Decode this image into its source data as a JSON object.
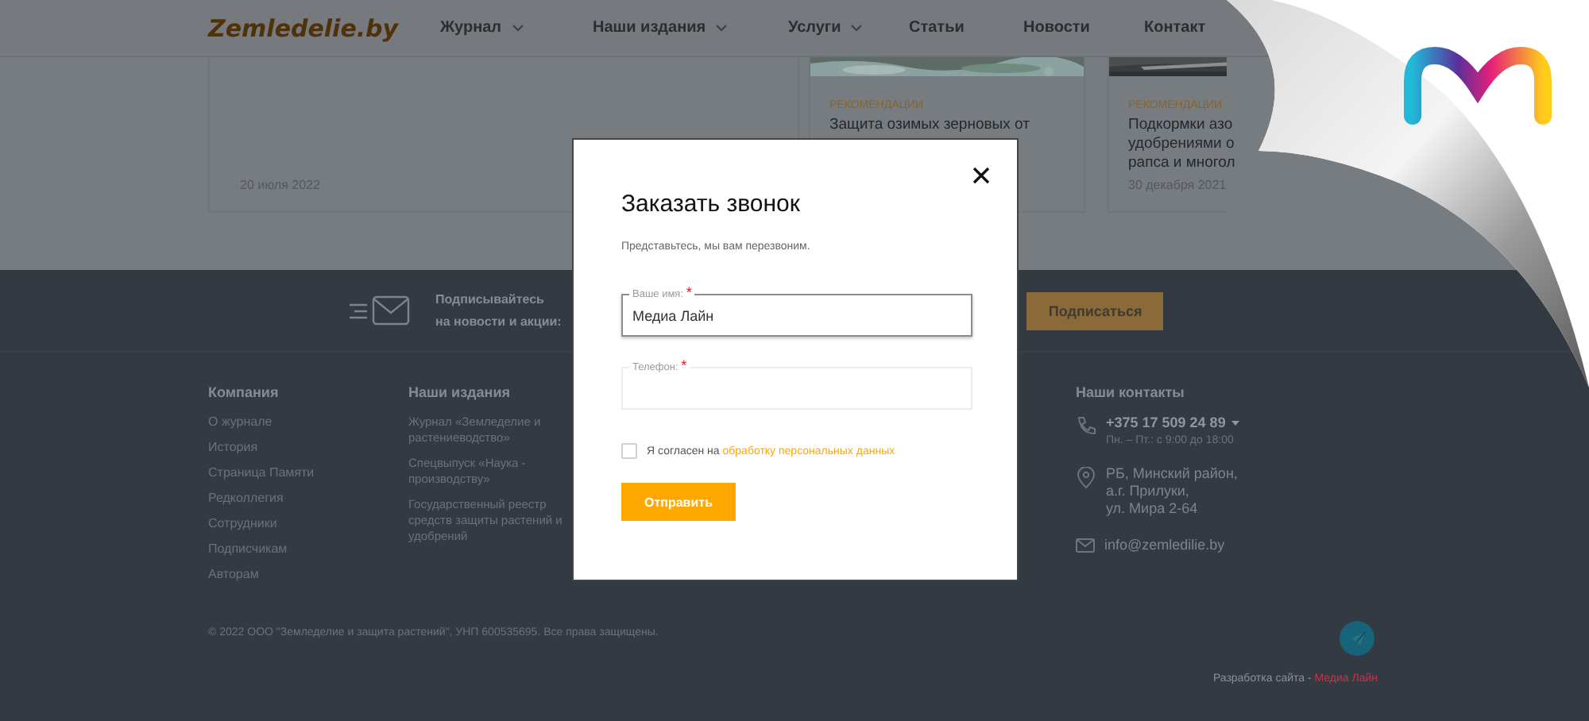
{
  "header": {
    "logo": "Zemledelie.by",
    "nav": [
      {
        "label": "Журнал",
        "dropdown": true
      },
      {
        "label": "Наши издания",
        "dropdown": true
      },
      {
        "label": "Услуги",
        "dropdown": true
      },
      {
        "label": "Статьи",
        "dropdown": false
      },
      {
        "label": "Новости",
        "dropdown": false
      },
      {
        "label": "Контакт",
        "dropdown": false
      }
    ]
  },
  "cards": [
    {
      "kind": "date-only",
      "date": "20 июля 2022"
    },
    {
      "kind": "article",
      "tag": "РЕКОМЕНДАЦИИ",
      "title_lines": [
        "Защита озимых зерновых от"
      ]
    },
    {
      "kind": "article",
      "tag": "РЕКОМЕНДАЦИИ",
      "title_lines": [
        "Подкормки азо",
        "удобрениями о",
        "рапса и многол"
      ],
      "date": "30 декабря 2021"
    }
  ],
  "footer": {
    "subscribe": {
      "text_lines": [
        "Подписывайтесь",
        "на новости и акции:"
      ],
      "button": "Подписаться"
    },
    "columns": [
      {
        "title": "Компания",
        "links": [
          "О журнале",
          "История",
          "Страница Памяти",
          "Редколлегия",
          "Сотрудники",
          "Подписчикам",
          "Авторам"
        ]
      },
      {
        "title": "Наши издания",
        "links": [
          "Журнал «Земледелие и растениеводство»",
          "Спецвыпуск «Наука - производству»",
          "Государственный реестр средств защиты растений и удобрений"
        ]
      }
    ],
    "contacts": {
      "title": "Наши контакты",
      "phone": "+375 17 509 24 89",
      "phone_dropdown": true,
      "hours": "Пн. – Пт.: с 9:00 до 18:00",
      "address_lines": [
        "РБ, Минский район,",
        "а.г. Прилуки,",
        "ул. Мира 2-64"
      ],
      "email": "info@zemledilie.by"
    },
    "copyright": "© 2022 ООО \"Земледелие и защита растений\", УНП 600535695. Все права защищены.",
    "developer": {
      "label": "Разработка сайта -",
      "link": "Медиа Лайн"
    }
  },
  "modal": {
    "title": "Заказать звонок",
    "subtitle": "Представьтесь, мы вам перезвоним.",
    "fields": [
      {
        "label": "Ваше имя:",
        "required_mark": "*",
        "value": "Медиа Лайн",
        "focused": true
      },
      {
        "label": "Телефон:",
        "required_mark": "*",
        "focused": false
      }
    ],
    "consent": {
      "text": "Я согласен на",
      "link": "обработку персональных данных",
      "checked": false
    },
    "submit": "Отправить"
  },
  "page_curl": {
    "kind": "curl"
  }
}
